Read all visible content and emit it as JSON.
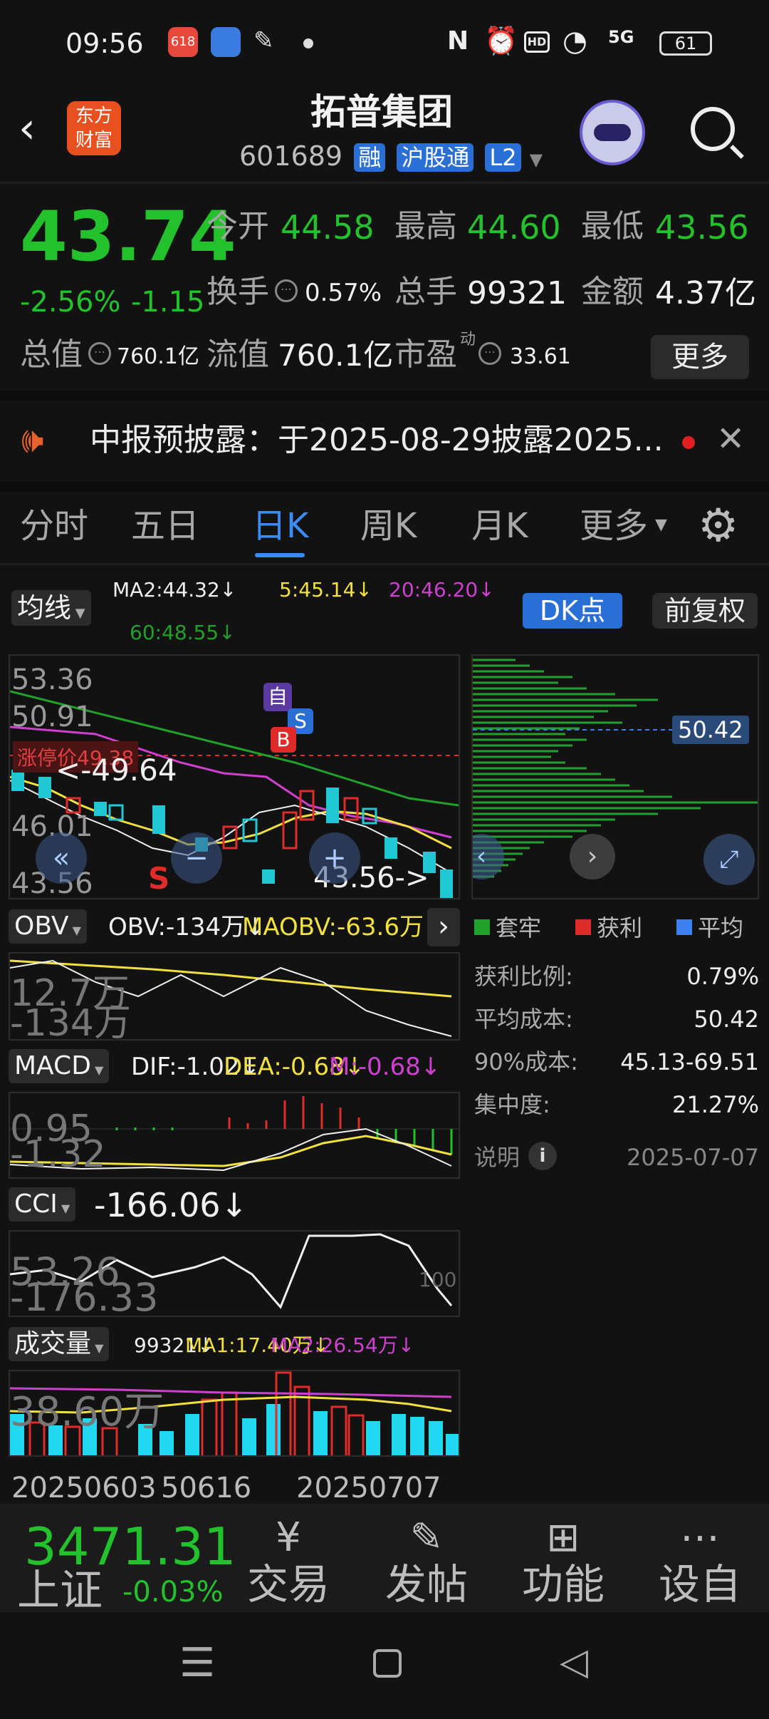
{
  "status_bar": {
    "time": "09:56",
    "battery": "61",
    "network": "5G",
    "app_badge": "618"
  },
  "header": {
    "title": "拓普集团",
    "code": "601689",
    "tags": [
      "融",
      "沪股通",
      "L2"
    ],
    "logo_text": [
      "东方",
      "财富"
    ]
  },
  "quote": {
    "price": "43.74",
    "change_pct": "-2.56%",
    "change": "-1.15",
    "open_label": "今开",
    "open": "44.58",
    "high_label": "最高",
    "high": "44.60",
    "low_label": "最低",
    "low": "43.56",
    "turnover_label": "换手",
    "turnover": "0.57%",
    "volume_label": "总手",
    "volume": "99321",
    "amount_label": "金额",
    "amount": "4.37亿",
    "total_cap_label": "总值",
    "total_cap": "760.1亿",
    "float_cap_label": "流值",
    "float_cap": "760.1亿",
    "pe_label": "市盈",
    "pe_sup": "动",
    "pe": "33.61",
    "more_label": "更多"
  },
  "notice": {
    "text": "中报预披露：于2025-08-29披露2025..."
  },
  "tabs": [
    "分时",
    "五日",
    "日K",
    "周K",
    "月K",
    "更多"
  ],
  "active_tab": "日K",
  "ma_bar": {
    "selector": "均线",
    "ma2": "MA2:44.32↓",
    "ma5": "5:45.14↓",
    "ma20": "20:46.20↓",
    "ma60": "60:48.55↓",
    "dk_label": "DK点",
    "adjust_label": "前复权"
  },
  "colors": {
    "up": "#e02b2b",
    "down": "#22c7d4",
    "green_text": "#23c22d",
    "ma5": "#f0e040",
    "ma20": "#d040d0",
    "ma60": "#21a12a",
    "accent": "#2a6fd6"
  },
  "kline": {
    "y_labels": [
      "53.36",
      "50.91",
      "46.01",
      "43.56"
    ],
    "limit_label": "涨停价49.38",
    "max_label": "<-49.64",
    "min_label": "43.56->",
    "markers": {
      "self": "自",
      "b": "B",
      "s": "S",
      "s_red": "S"
    }
  },
  "chip_dist": {
    "avg_label": "50.42",
    "legend": [
      "套牢",
      "获利",
      "平均"
    ],
    "rows": [
      {
        "label": "获利比例:",
        "value": "0.79%"
      },
      {
        "label": "平均成本:",
        "value": "50.42"
      },
      {
        "label": "90%成本:",
        "value": "45.13-69.51"
      },
      {
        "label": "集中度:",
        "value": "21.27%"
      }
    ],
    "note_label": "说明",
    "date": "2025-07-07"
  },
  "obv": {
    "name": "OBV",
    "obv": "OBV:-134万↓",
    "maobv": "MAOBV:-63.6万↓",
    "top": "12.7万",
    "bottom": "-134万"
  },
  "macd": {
    "name": "MACD",
    "dif": "DIF:-1.02↓",
    "dea": "DEA:-0.68↓",
    "m": "M:-0.68↓",
    "top": "0.95",
    "bottom": "-1.32"
  },
  "cci": {
    "name": "CCI",
    "value": "-166.06↓",
    "top": "53.26",
    "bottom": "-176.33",
    "level": "100"
  },
  "vol": {
    "name": "成交量",
    "vol": "99321↓",
    "ma1": "MA1:17.40万↓",
    "ma2": "MA2:26.54万↓",
    "top": "38.60万"
  },
  "dates": [
    "20250603",
    "50616",
    "20250707"
  ],
  "bottom_nav": {
    "index_value": "3471.31",
    "index_name": "上证",
    "index_change": "-0.03%",
    "items": [
      "交易",
      "发帖",
      "功能",
      "设自"
    ]
  }
}
